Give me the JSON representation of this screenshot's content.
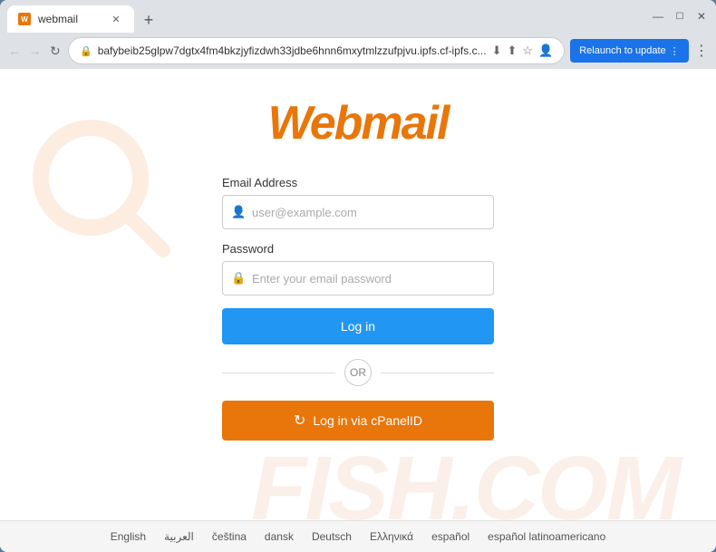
{
  "browser": {
    "tab": {
      "title": "webmail",
      "favicon": "W"
    },
    "address": "bafybeib25glpw7dgtx4fm4bkzjyfizdwh33jdbe6hnn6mxytmlzzufpjvu.ipfs.cf-ipfs.c...",
    "new_tab_label": "+",
    "relaunch_btn": "Relaunch to update"
  },
  "page": {
    "logo": "Webmail",
    "email_label": "Email Address",
    "email_placeholder": "user@example.com",
    "password_label": "Password",
    "password_placeholder": "Enter your email password",
    "login_button": "Log in",
    "or_text": "OR",
    "cpanel_button": "Log in via cPanelID"
  },
  "watermark": {
    "text": "FISH.COM"
  },
  "languages": [
    "English",
    "العربية",
    "čeština",
    "dansk",
    "Deutsch",
    "Ελληνικά",
    "español",
    "español latinoamericano"
  ]
}
